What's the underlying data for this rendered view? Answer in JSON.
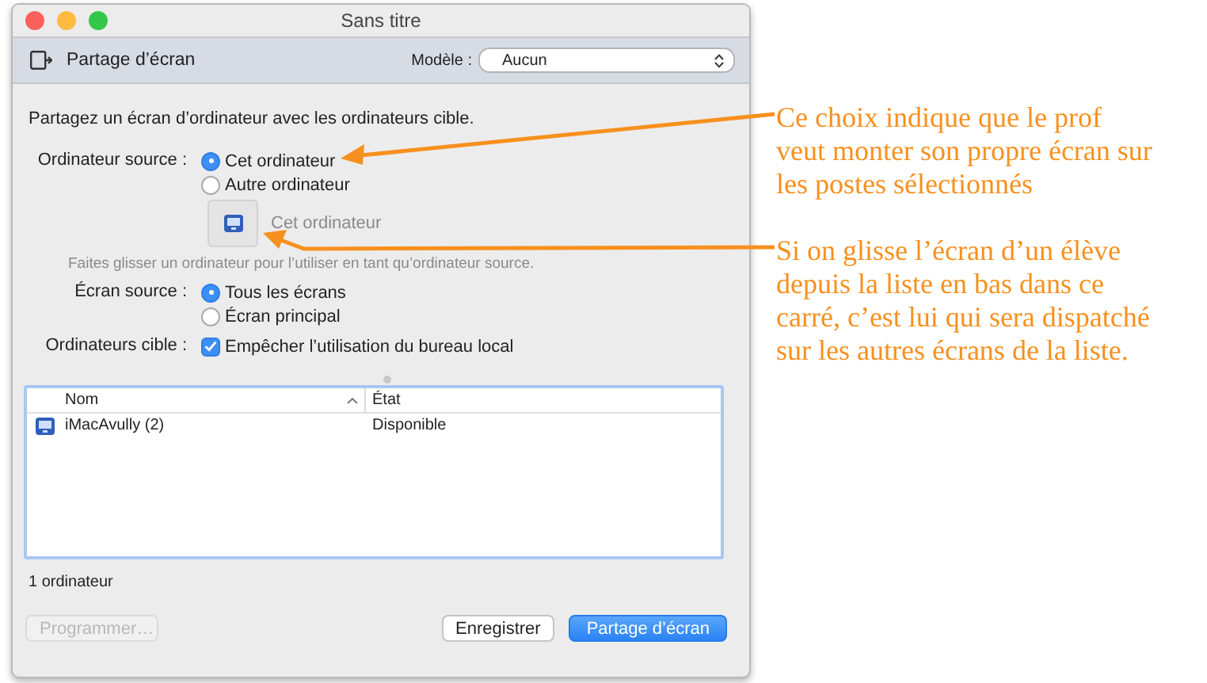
{
  "window": {
    "title": "Sans titre"
  },
  "toolbar": {
    "title": "Partage d’écran",
    "template_label": "Modèle :",
    "template_value": "Aucun"
  },
  "description": "Partagez un écran d’ordinateur avec les ordinateurs cible.",
  "source": {
    "label": "Ordinateur source :",
    "options": [
      {
        "label": "Cet ordinateur",
        "selected": true
      },
      {
        "label": "Autre ordinateur",
        "selected": false
      }
    ]
  },
  "drop_target": {
    "label": "Cet ordinateur"
  },
  "hint": "Faites glisser un ordinateur pour l’utiliser en tant qu’ordinateur source.",
  "screen_source": {
    "label": "Écran source :",
    "options": [
      {
        "label": "Tous les écrans",
        "selected": true
      },
      {
        "label": "Écran principal",
        "selected": false
      }
    ]
  },
  "targets": {
    "label": "Ordinateurs cible :",
    "checkbox": {
      "label": "Empêcher l’utilisation du bureau local",
      "checked": true
    }
  },
  "table": {
    "columns": [
      {
        "label": "Nom",
        "sorted": true
      },
      {
        "label": "État",
        "sorted": false
      }
    ],
    "rows": [
      {
        "name": "iMacAvully (2)",
        "state": "Disponible"
      }
    ]
  },
  "count": "1 ordinateur",
  "buttons": [
    {
      "label": "Programmer…",
      "kind": "disabled"
    },
    {
      "label": "Enregistrer",
      "kind": "default"
    },
    {
      "label": "Partage d’écran",
      "kind": "primary"
    }
  ],
  "annotations": [
    {
      "text": "Ce choix indique que le prof veut monter son propre écran sur les postes sélectionnés"
    },
    {
      "text": "Si on glisse l’écran d’un élève depuis la liste en bas dans ce carré, c’est lui qui sera dispatché sur les autres écrans de la liste."
    }
  ]
}
